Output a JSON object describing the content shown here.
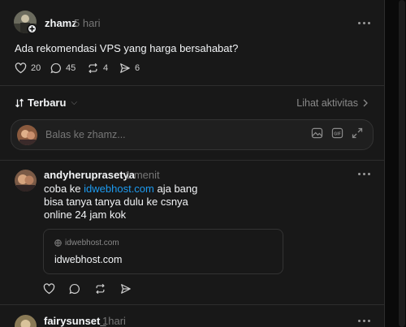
{
  "post": {
    "username": "zhamz",
    "time": "5 hari",
    "text": "Ada rekomendasi VPS yang harga bersahabat?",
    "likes": "20",
    "comments": "45",
    "reposts": "4",
    "shares": "6"
  },
  "controls": {
    "sort_label": "Terbaru",
    "activity_label": "Lihat aktivitas",
    "reply_placeholder": "Balas ke zhamz..."
  },
  "replies": [
    {
      "username": "andyheruprasetya",
      "time": "1 menit",
      "line1_prefix": "coba ke ",
      "line1_link": "idwebhost.com",
      "line1_suffix": " aja bang",
      "line2": "bisa tanya tanya dulu ke csnya",
      "line3": "online 24 jam kok",
      "card_domain": "idwebhost.com",
      "card_title": "idwebhost.com"
    },
    {
      "username": "fairysunset_",
      "time": "1hari"
    }
  ],
  "colors": {
    "background": "#181818",
    "link": "#1d9bf0",
    "muted": "#777777"
  }
}
